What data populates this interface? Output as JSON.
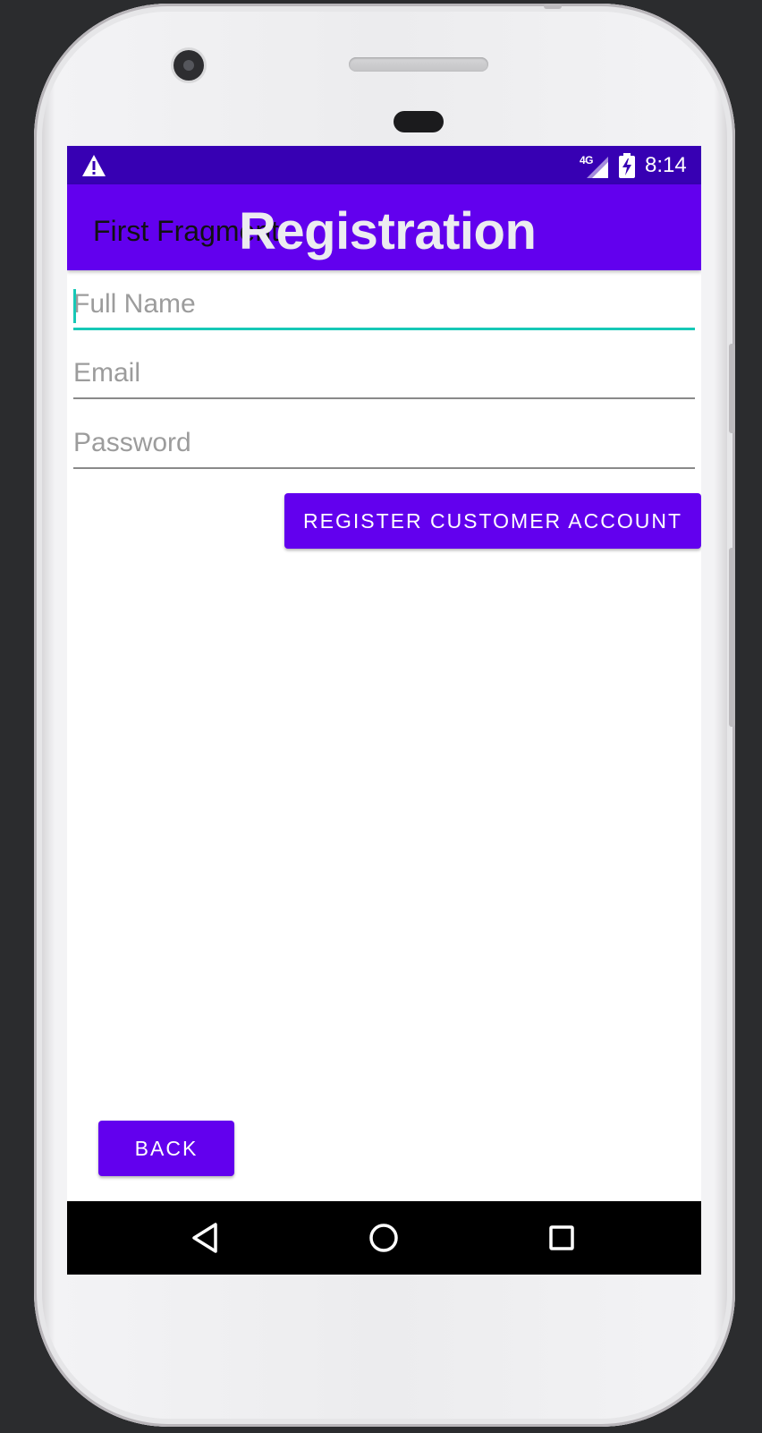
{
  "status_bar": {
    "network": "4G",
    "time": "8:14",
    "icons": [
      "warning-icon",
      "signal-icon",
      "battery-charging-icon"
    ]
  },
  "app_bar": {
    "fragment_label": "First Fragment",
    "title": "Registration"
  },
  "form": {
    "full_name": {
      "placeholder": "Full Name",
      "value": ""
    },
    "email": {
      "placeholder": "Email",
      "value": ""
    },
    "password": {
      "placeholder": "Password",
      "value": ""
    },
    "register_label": "REGISTER CUSTOMER ACCOUNT"
  },
  "back_label": "BACK",
  "nav_bar": {
    "icons": [
      "back-triangle-icon",
      "home-circle-icon",
      "recents-square-icon"
    ]
  },
  "colors": {
    "primary": "#6200ee",
    "primary_dark": "#3700b3",
    "accent": "#16c8b6"
  }
}
